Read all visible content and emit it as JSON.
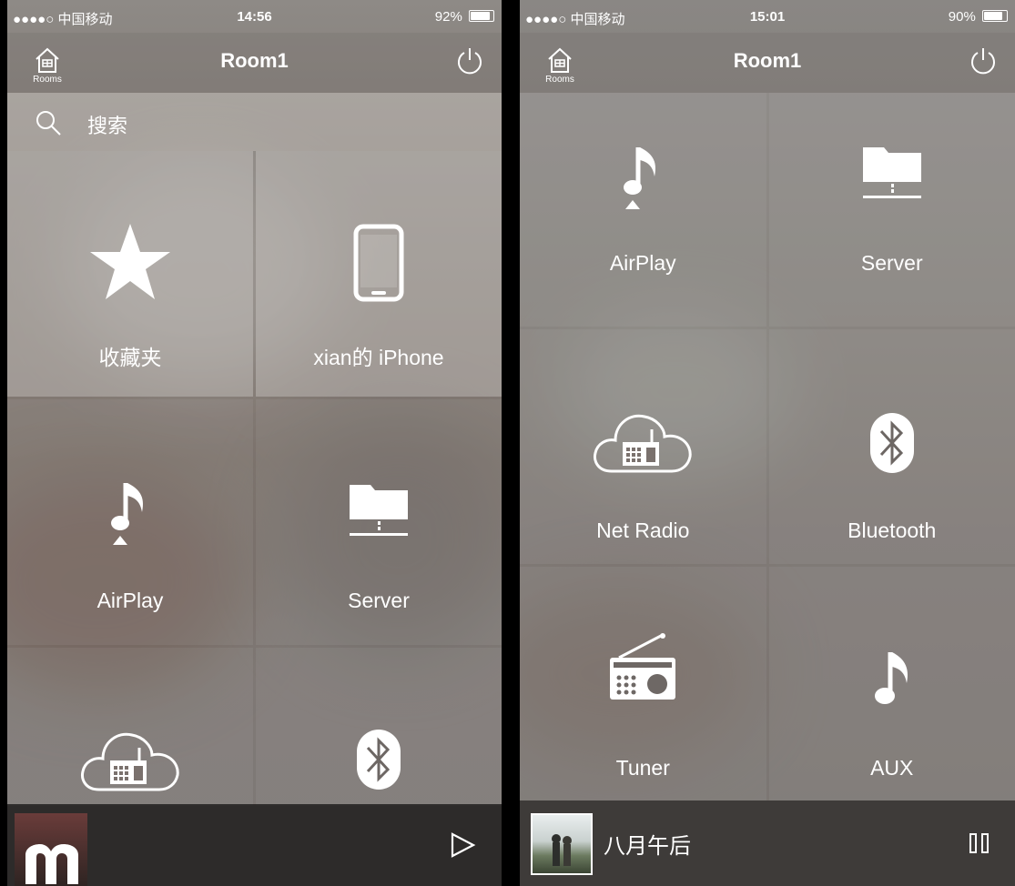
{
  "left": {
    "status": {
      "carrier": "●●●●○ 中国移动",
      "time": "14:56",
      "battery": "92%",
      "battery_level": 0.92
    },
    "nav": {
      "rooms_label": "Rooms",
      "title": "Room1"
    },
    "search": {
      "placeholder": "搜索"
    },
    "tiles": [
      {
        "label": "收藏夹",
        "icon": "star-icon"
      },
      {
        "label": "xian的 iPhone",
        "icon": "phone-icon"
      },
      {
        "label": "AirPlay",
        "icon": "airplay-music-icon"
      },
      {
        "label": "Server",
        "icon": "server-folder-icon"
      },
      {
        "label": "",
        "icon": "net-radio-cloud-icon"
      },
      {
        "label": "",
        "icon": "bluetooth-icon"
      }
    ],
    "player": {
      "track": "",
      "control": "play-icon"
    }
  },
  "right": {
    "status": {
      "carrier": "●●●●○ 中国移动",
      "time": "15:01",
      "battery": "90%",
      "battery_level": 0.9
    },
    "nav": {
      "rooms_label": "Rooms",
      "title": "Room1"
    },
    "tiles": [
      {
        "label": "AirPlay",
        "icon": "airplay-music-icon"
      },
      {
        "label": "Server",
        "icon": "server-folder-icon"
      },
      {
        "label": "Net Radio",
        "icon": "net-radio-cloud-icon"
      },
      {
        "label": "Bluetooth",
        "icon": "bluetooth-icon"
      },
      {
        "label": "Tuner",
        "icon": "radio-tuner-icon"
      },
      {
        "label": "AUX",
        "icon": "music-note-icon"
      }
    ],
    "player": {
      "track": "八月午后",
      "control": "pause-icon"
    }
  }
}
